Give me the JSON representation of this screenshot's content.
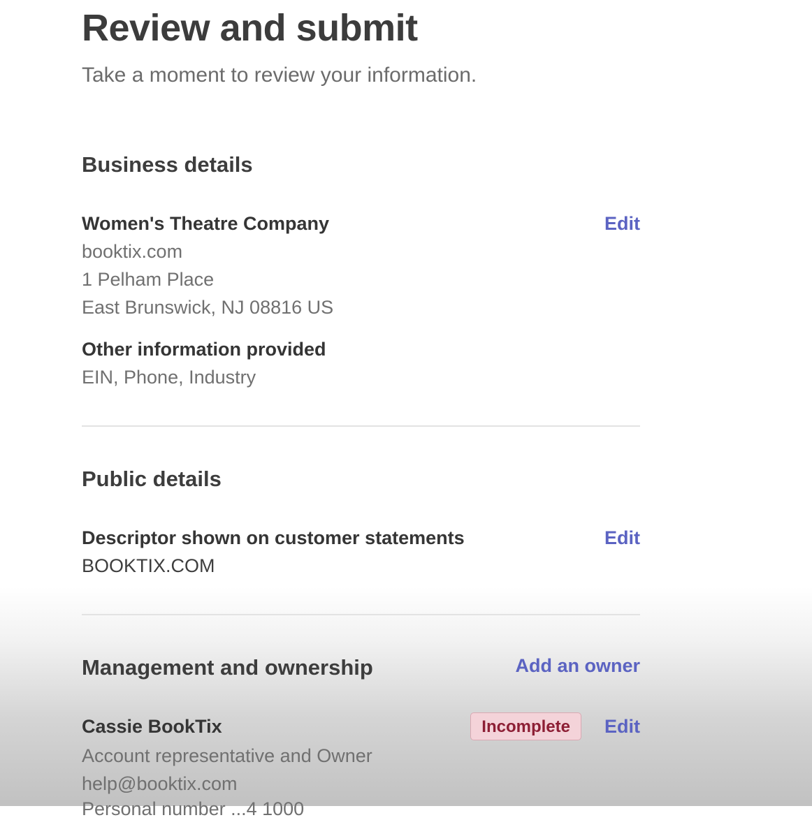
{
  "page": {
    "title": "Review and submit",
    "subtitle": "Take a moment to review your information."
  },
  "business_details": {
    "heading": "Business details",
    "company_name": "Women's Theatre Company",
    "edit_label": "Edit",
    "lines": [
      "booktix.com",
      "1 Pelham Place",
      "East Brunswick, NJ 08816 US"
    ],
    "other_info_label": "Other information provided",
    "other_info_value": "EIN, Phone, Industry"
  },
  "public_details": {
    "heading": "Public details",
    "descriptor_label": "Descriptor shown on customer statements",
    "edit_label": "Edit",
    "descriptor_value": "BOOKTIX.COM"
  },
  "management": {
    "heading": "Management and ownership",
    "add_owner_label": "Add an owner",
    "owner": {
      "name": "Cassie BookTix",
      "status_badge": "Incomplete",
      "edit_label": "Edit",
      "role": "Account representative and Owner",
      "email": "help@booktix.com",
      "partial_line": "Personal number ...4 1000"
    }
  },
  "colors": {
    "accent_link": "#5b63c2",
    "badge_bg": "#f4d3d9",
    "badge_text": "#8d1f35"
  }
}
